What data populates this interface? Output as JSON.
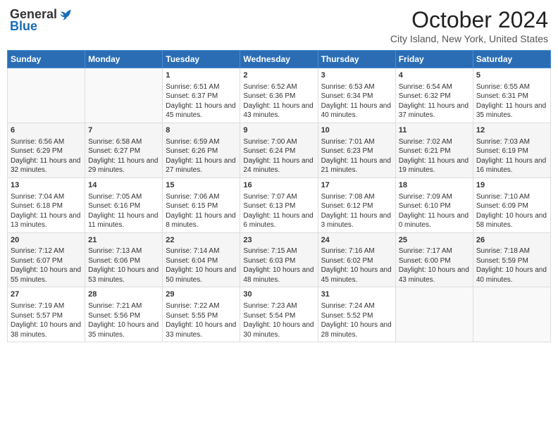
{
  "header": {
    "logo_general": "General",
    "logo_blue": "Blue",
    "month_title": "October 2024",
    "location": "City Island, New York, United States"
  },
  "days_of_week": [
    "Sunday",
    "Monday",
    "Tuesday",
    "Wednesday",
    "Thursday",
    "Friday",
    "Saturday"
  ],
  "weeks": [
    [
      {
        "day": "",
        "sunrise": "",
        "sunset": "",
        "daylight": ""
      },
      {
        "day": "",
        "sunrise": "",
        "sunset": "",
        "daylight": ""
      },
      {
        "day": "1",
        "sunrise": "Sunrise: 6:51 AM",
        "sunset": "Sunset: 6:37 PM",
        "daylight": "Daylight: 11 hours and 45 minutes."
      },
      {
        "day": "2",
        "sunrise": "Sunrise: 6:52 AM",
        "sunset": "Sunset: 6:36 PM",
        "daylight": "Daylight: 11 hours and 43 minutes."
      },
      {
        "day": "3",
        "sunrise": "Sunrise: 6:53 AM",
        "sunset": "Sunset: 6:34 PM",
        "daylight": "Daylight: 11 hours and 40 minutes."
      },
      {
        "day": "4",
        "sunrise": "Sunrise: 6:54 AM",
        "sunset": "Sunset: 6:32 PM",
        "daylight": "Daylight: 11 hours and 37 minutes."
      },
      {
        "day": "5",
        "sunrise": "Sunrise: 6:55 AM",
        "sunset": "Sunset: 6:31 PM",
        "daylight": "Daylight: 11 hours and 35 minutes."
      }
    ],
    [
      {
        "day": "6",
        "sunrise": "Sunrise: 6:56 AM",
        "sunset": "Sunset: 6:29 PM",
        "daylight": "Daylight: 11 hours and 32 minutes."
      },
      {
        "day": "7",
        "sunrise": "Sunrise: 6:58 AM",
        "sunset": "Sunset: 6:27 PM",
        "daylight": "Daylight: 11 hours and 29 minutes."
      },
      {
        "day": "8",
        "sunrise": "Sunrise: 6:59 AM",
        "sunset": "Sunset: 6:26 PM",
        "daylight": "Daylight: 11 hours and 27 minutes."
      },
      {
        "day": "9",
        "sunrise": "Sunrise: 7:00 AM",
        "sunset": "Sunset: 6:24 PM",
        "daylight": "Daylight: 11 hours and 24 minutes."
      },
      {
        "day": "10",
        "sunrise": "Sunrise: 7:01 AM",
        "sunset": "Sunset: 6:23 PM",
        "daylight": "Daylight: 11 hours and 21 minutes."
      },
      {
        "day": "11",
        "sunrise": "Sunrise: 7:02 AM",
        "sunset": "Sunset: 6:21 PM",
        "daylight": "Daylight: 11 hours and 19 minutes."
      },
      {
        "day": "12",
        "sunrise": "Sunrise: 7:03 AM",
        "sunset": "Sunset: 6:19 PM",
        "daylight": "Daylight: 11 hours and 16 minutes."
      }
    ],
    [
      {
        "day": "13",
        "sunrise": "Sunrise: 7:04 AM",
        "sunset": "Sunset: 6:18 PM",
        "daylight": "Daylight: 11 hours and 13 minutes."
      },
      {
        "day": "14",
        "sunrise": "Sunrise: 7:05 AM",
        "sunset": "Sunset: 6:16 PM",
        "daylight": "Daylight: 11 hours and 11 minutes."
      },
      {
        "day": "15",
        "sunrise": "Sunrise: 7:06 AM",
        "sunset": "Sunset: 6:15 PM",
        "daylight": "Daylight: 11 hours and 8 minutes."
      },
      {
        "day": "16",
        "sunrise": "Sunrise: 7:07 AM",
        "sunset": "Sunset: 6:13 PM",
        "daylight": "Daylight: 11 hours and 6 minutes."
      },
      {
        "day": "17",
        "sunrise": "Sunrise: 7:08 AM",
        "sunset": "Sunset: 6:12 PM",
        "daylight": "Daylight: 11 hours and 3 minutes."
      },
      {
        "day": "18",
        "sunrise": "Sunrise: 7:09 AM",
        "sunset": "Sunset: 6:10 PM",
        "daylight": "Daylight: 11 hours and 0 minutes."
      },
      {
        "day": "19",
        "sunrise": "Sunrise: 7:10 AM",
        "sunset": "Sunset: 6:09 PM",
        "daylight": "Daylight: 10 hours and 58 minutes."
      }
    ],
    [
      {
        "day": "20",
        "sunrise": "Sunrise: 7:12 AM",
        "sunset": "Sunset: 6:07 PM",
        "daylight": "Daylight: 10 hours and 55 minutes."
      },
      {
        "day": "21",
        "sunrise": "Sunrise: 7:13 AM",
        "sunset": "Sunset: 6:06 PM",
        "daylight": "Daylight: 10 hours and 53 minutes."
      },
      {
        "day": "22",
        "sunrise": "Sunrise: 7:14 AM",
        "sunset": "Sunset: 6:04 PM",
        "daylight": "Daylight: 10 hours and 50 minutes."
      },
      {
        "day": "23",
        "sunrise": "Sunrise: 7:15 AM",
        "sunset": "Sunset: 6:03 PM",
        "daylight": "Daylight: 10 hours and 48 minutes."
      },
      {
        "day": "24",
        "sunrise": "Sunrise: 7:16 AM",
        "sunset": "Sunset: 6:02 PM",
        "daylight": "Daylight: 10 hours and 45 minutes."
      },
      {
        "day": "25",
        "sunrise": "Sunrise: 7:17 AM",
        "sunset": "Sunset: 6:00 PM",
        "daylight": "Daylight: 10 hours and 43 minutes."
      },
      {
        "day": "26",
        "sunrise": "Sunrise: 7:18 AM",
        "sunset": "Sunset: 5:59 PM",
        "daylight": "Daylight: 10 hours and 40 minutes."
      }
    ],
    [
      {
        "day": "27",
        "sunrise": "Sunrise: 7:19 AM",
        "sunset": "Sunset: 5:57 PM",
        "daylight": "Daylight: 10 hours and 38 minutes."
      },
      {
        "day": "28",
        "sunrise": "Sunrise: 7:21 AM",
        "sunset": "Sunset: 5:56 PM",
        "daylight": "Daylight: 10 hours and 35 minutes."
      },
      {
        "day": "29",
        "sunrise": "Sunrise: 7:22 AM",
        "sunset": "Sunset: 5:55 PM",
        "daylight": "Daylight: 10 hours and 33 minutes."
      },
      {
        "day": "30",
        "sunrise": "Sunrise: 7:23 AM",
        "sunset": "Sunset: 5:54 PM",
        "daylight": "Daylight: 10 hours and 30 minutes."
      },
      {
        "day": "31",
        "sunrise": "Sunrise: 7:24 AM",
        "sunset": "Sunset: 5:52 PM",
        "daylight": "Daylight: 10 hours and 28 minutes."
      },
      {
        "day": "",
        "sunrise": "",
        "sunset": "",
        "daylight": ""
      },
      {
        "day": "",
        "sunrise": "",
        "sunset": "",
        "daylight": ""
      }
    ]
  ]
}
